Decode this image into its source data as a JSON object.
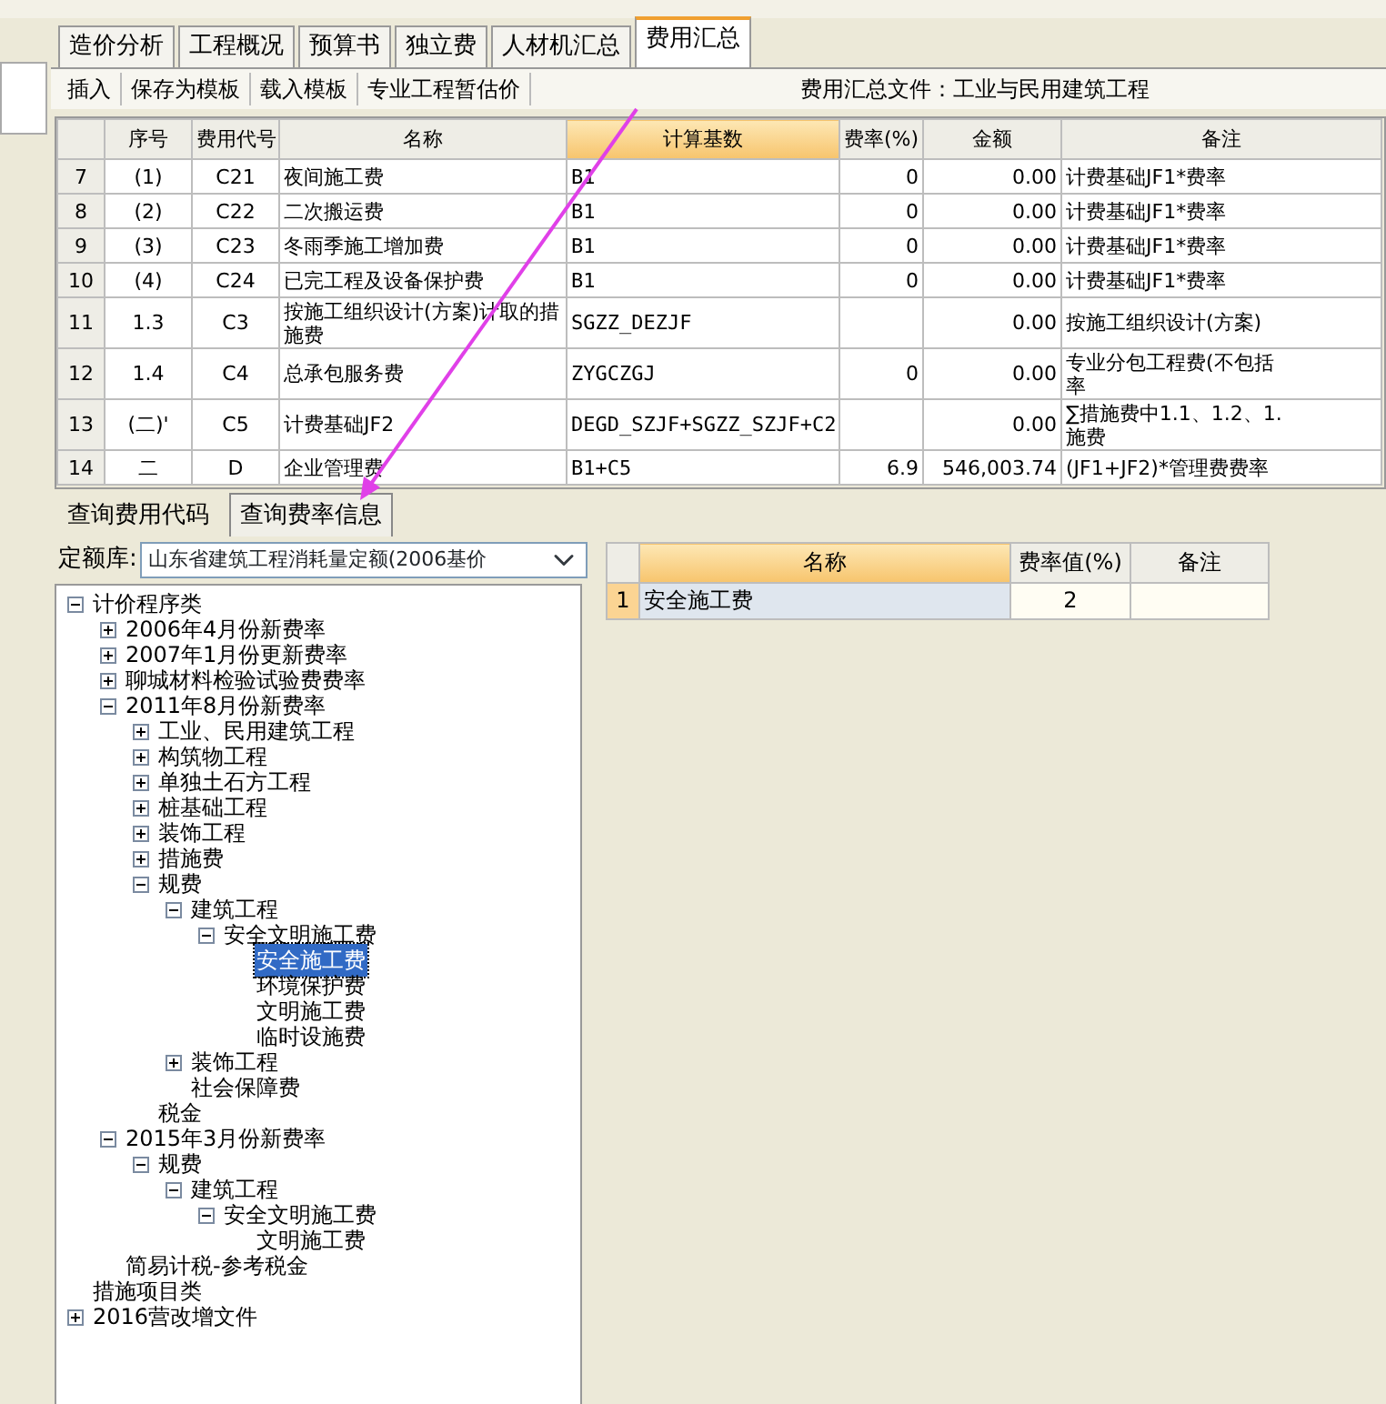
{
  "tabs": [
    {
      "label": "造价分析",
      "selected": false
    },
    {
      "label": "工程概况",
      "selected": false
    },
    {
      "label": "预算书",
      "selected": false
    },
    {
      "label": "独立费",
      "selected": false
    },
    {
      "label": "人材机汇总",
      "selected": false
    },
    {
      "label": "费用汇总",
      "selected": true
    }
  ],
  "actions": [
    "插入",
    "保存为模板",
    "载入模板",
    "专业工程暂估价"
  ],
  "file_label": "费用汇总文件：工业与民用建筑工程",
  "fee_table": {
    "columns": [
      {
        "label": "序号",
        "selected": false
      },
      {
        "label": "费用代号",
        "selected": false
      },
      {
        "label": "名称",
        "selected": false
      },
      {
        "label": "计算基数",
        "selected": true
      },
      {
        "label": "费率(%)",
        "selected": false
      },
      {
        "label": "金额",
        "selected": false
      },
      {
        "label": "备注",
        "selected": false
      }
    ],
    "rows": [
      {
        "num": "7",
        "cells": [
          "(1)",
          "C21",
          "夜间施工费",
          "B1",
          "0",
          "0.00"
        ],
        "note": [
          "计费基础JF1*费率"
        ]
      },
      {
        "num": "8",
        "cells": [
          "(2)",
          "C22",
          "二次搬运费",
          "B1",
          "0",
          "0.00"
        ],
        "note": [
          "计费基础JF1*费率"
        ]
      },
      {
        "num": "9",
        "cells": [
          "(3)",
          "C23",
          "冬雨季施工增加费",
          "B1",
          "0",
          "0.00"
        ],
        "note": [
          "计费基础JF1*费率"
        ]
      },
      {
        "num": "10",
        "cells": [
          "(4)",
          "C24",
          "已完工程及设备保护费",
          "B1",
          "0",
          "0.00"
        ],
        "note": [
          "计费基础JF1*费率"
        ]
      },
      {
        "num": "11",
        "cells": [
          "1.3",
          "C3",
          "按施工组织设计(方案)计取的措施费",
          "SGZZ_DEZJF",
          "",
          "0.00"
        ],
        "note": [
          "按施工组织设计(方案)"
        ]
      },
      {
        "num": "12",
        "cells": [
          "1.4",
          "C4",
          "总承包服务费",
          "ZYGCZGJ",
          "0",
          "0.00"
        ],
        "note": [
          "专业分包工程费(不包括",
          "率"
        ]
      },
      {
        "num": "13",
        "cells": [
          "(二)'",
          "C5",
          "计费基础JF2",
          "DEGD_SZJF+SGZZ_SZJF+C2",
          "",
          "0.00"
        ],
        "note": [
          "∑措施费中1.1、1.2、1.",
          "施费"
        ]
      },
      {
        "num": "14",
        "cells": [
          "二",
          "D",
          "企业管理费",
          "B1+C5",
          "6.9",
          "546,003.74"
        ],
        "note": [
          "(JF1+JF2)*管理费费率"
        ]
      }
    ]
  },
  "lower_tabs": [
    {
      "label": "查询费用代码",
      "selected": false
    },
    {
      "label": "查询费率信息",
      "selected": true
    }
  ],
  "quota_label": "定额库:",
  "quota_value": "山东省建筑工程消耗量定额(2006基价",
  "tree": [
    {
      "label": "计价程序类",
      "expanded": true,
      "selected": false,
      "children": [
        {
          "label": "2006年4月份新费率",
          "expanded": false,
          "selected": false
        },
        {
          "label": "2007年1月份更新费率",
          "expanded": false,
          "selected": false
        },
        {
          "label": "聊城材料检验试验费费率",
          "expanded": false,
          "selected": false
        },
        {
          "label": "2011年8月份新费率",
          "expanded": true,
          "selected": false,
          "children": [
            {
              "label": "工业、民用建筑工程",
              "expanded": false,
              "selected": false
            },
            {
              "label": "构筑物工程",
              "expanded": false,
              "selected": false
            },
            {
              "label": "单独土石方工程",
              "expanded": false,
              "selected": false
            },
            {
              "label": "桩基础工程",
              "expanded": false,
              "selected": false
            },
            {
              "label": "装饰工程",
              "expanded": false,
              "selected": false
            },
            {
              "label": "措施费",
              "expanded": false,
              "selected": false
            },
            {
              "label": "规费",
              "expanded": true,
              "selected": false,
              "children": [
                {
                  "label": "建筑工程",
                  "expanded": true,
                  "selected": false,
                  "children": [
                    {
                      "label": "安全文明施工费",
                      "expanded": true,
                      "selected": false,
                      "children": [
                        {
                          "label": "安全施工费",
                          "selected": true
                        },
                        {
                          "label": "环境保护费",
                          "selected": false
                        },
                        {
                          "label": "文明施工费",
                          "selected": false
                        },
                        {
                          "label": "临时设施费",
                          "selected": false
                        }
                      ]
                    }
                  ]
                },
                {
                  "label": "装饰工程",
                  "expanded": false,
                  "selected": false
                },
                {
                  "label": "社会保障费",
                  "selected": false
                }
              ]
            },
            {
              "label": "税金",
              "selected": false
            }
          ]
        },
        {
          "label": "2015年3月份新费率",
          "expanded": true,
          "selected": false,
          "children": [
            {
              "label": "规费",
              "expanded": true,
              "selected": false,
              "children": [
                {
                  "label": "建筑工程",
                  "expanded": true,
                  "selected": false,
                  "children": [
                    {
                      "label": "安全文明施工费",
                      "expanded": true,
                      "selected": false,
                      "children": [
                        {
                          "label": "文明施工费",
                          "selected": false
                        }
                      ]
                    }
                  ]
                }
              ]
            }
          ]
        },
        {
          "label": "简易计税-参考税金",
          "selected": false
        }
      ]
    },
    {
      "label": "措施项目类",
      "selected": false
    },
    {
      "label": "2016营改增文件",
      "expanded": false,
      "selected": false
    }
  ],
  "rate_table": {
    "columns": [
      {
        "label": "名称",
        "selected": true
      },
      {
        "label": "费率值(%)",
        "selected": false
      },
      {
        "label": "备注",
        "selected": false
      }
    ],
    "rows": [
      {
        "num": "1",
        "name": "安全施工费",
        "rate": "2",
        "note": "",
        "selected": true
      }
    ]
  }
}
